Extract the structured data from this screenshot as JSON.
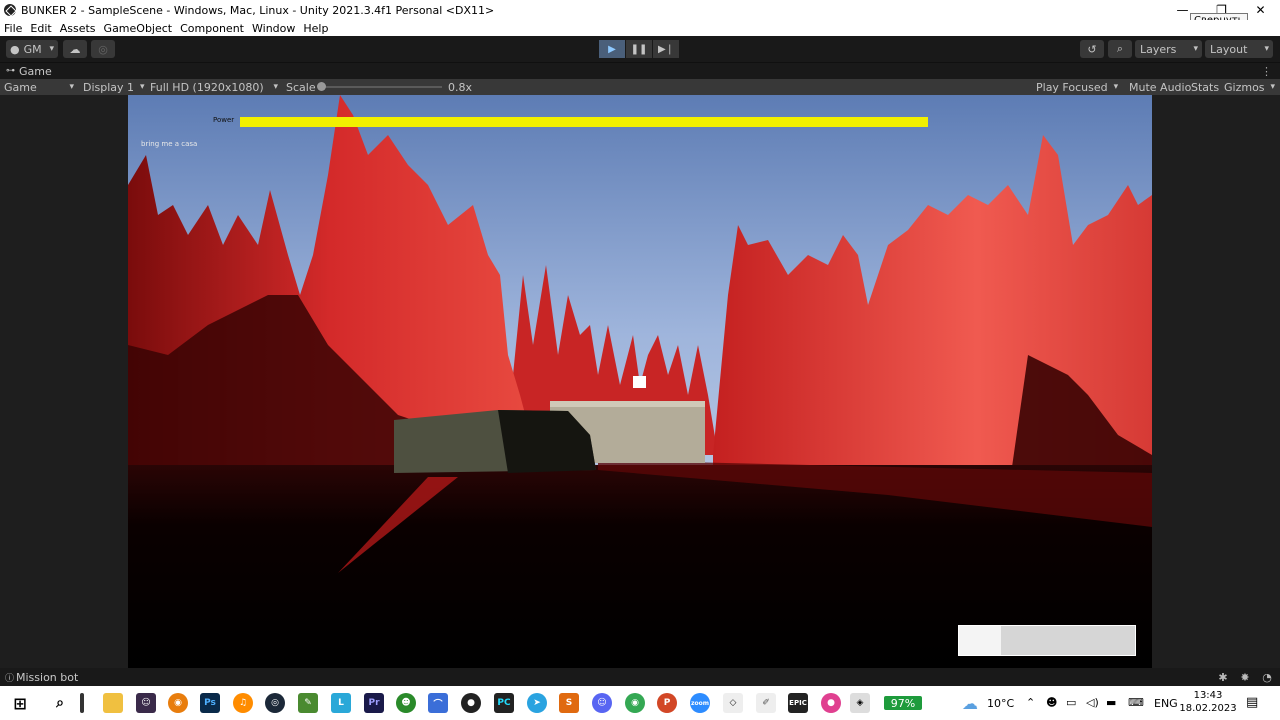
{
  "window": {
    "title": "BUNKER 2 - SampleScene - Windows, Mac, Linux - Unity 2021.3.4f1 Personal <DX11>",
    "tooltip": "Свернуть"
  },
  "menu": [
    "File",
    "Edit",
    "Assets",
    "GameObject",
    "Component",
    "Window",
    "Help"
  ],
  "toolbar": {
    "account_label": "GM",
    "layers_label": "Layers",
    "layout_label": "Layout"
  },
  "tab": {
    "label": "Game"
  },
  "gamebar": {
    "view_mode": "Game",
    "display": "Display 1",
    "resolution": "Full HD (1920x1080)",
    "scale_label": "Scale",
    "scale_value": "0.8x",
    "scale_fraction": 0.0,
    "play_focused": "Play Focused",
    "mute_audio": "Mute Audio",
    "stats": "Stats",
    "gizmos": "Gizmos"
  },
  "hud": {
    "power_label": "Power",
    "power_fraction": 1.0,
    "mission_text": "bring me a casa",
    "panel_fill_fraction": 0.24
  },
  "statusbar": {
    "message": "Mission bot"
  },
  "taskbar": {
    "battery": "97%",
    "temperature": "10°C",
    "language": "ENG",
    "time": "13:43",
    "date": "18.02.2023"
  },
  "colors": {
    "unity_dark": "#191919",
    "play_active": "#4a5f7a",
    "power_bar": "#f2f000",
    "terrain_red": "#d42a2a",
    "sky": "#7d9ac9"
  }
}
